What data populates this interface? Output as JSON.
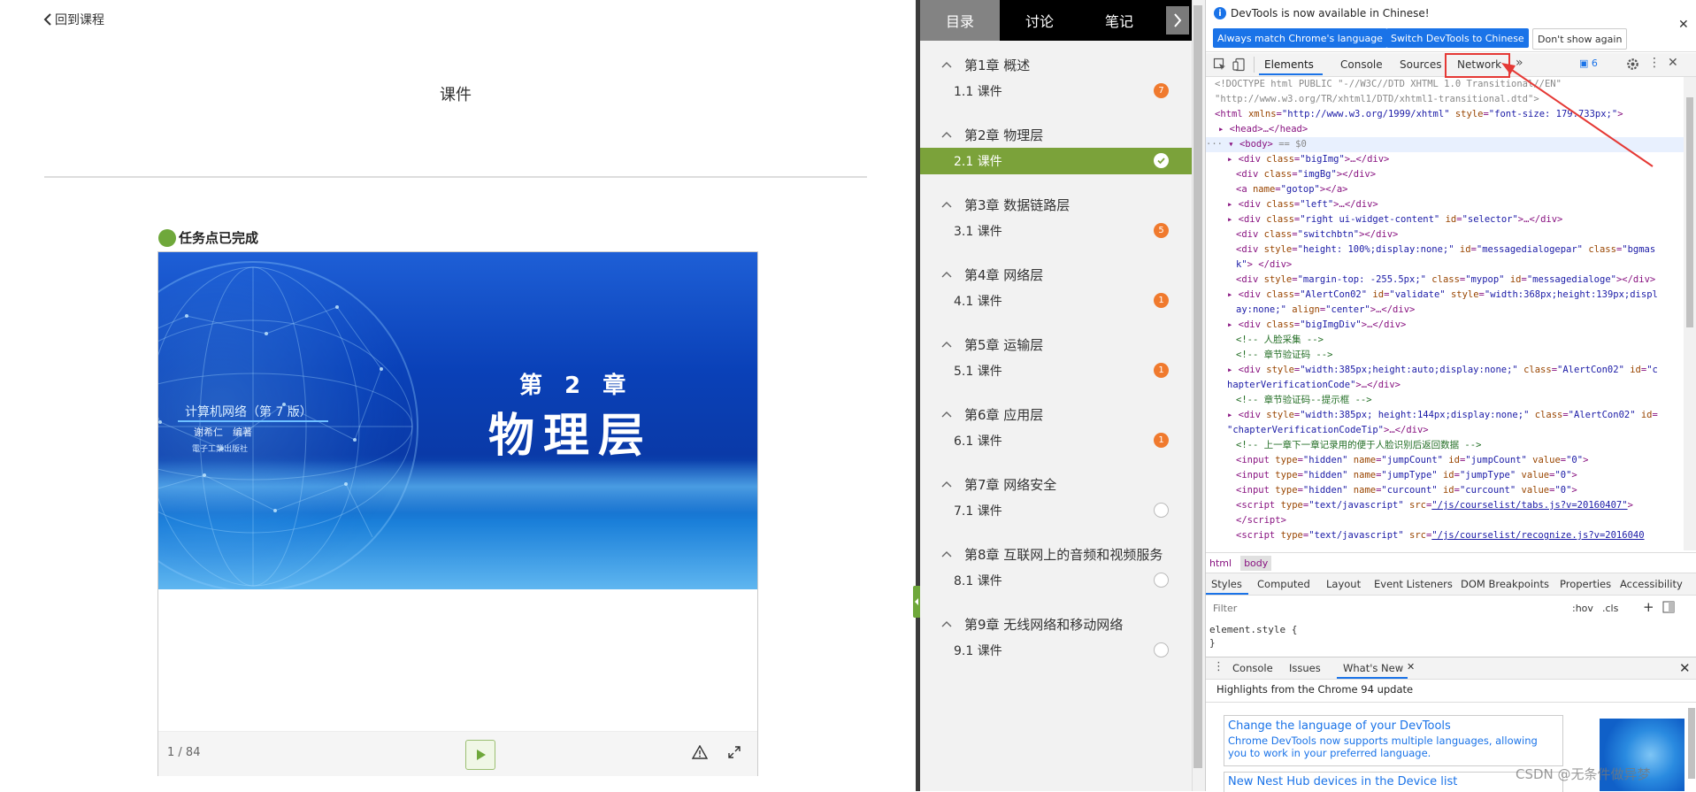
{
  "page": {
    "back_link": "回到课程",
    "title": "课件",
    "task_status": "任务点已完成"
  },
  "slide": {
    "chapter": "第 2 章",
    "title": "物理层",
    "book": "计算机网络（第 7 版）",
    "author": "谢希仁　编著",
    "publisher": "電子工業出版社"
  },
  "viewer": {
    "page_current": "1",
    "page_total": "/ 84"
  },
  "catalog": {
    "tabs": [
      "目录",
      "讨论",
      "笔记"
    ],
    "chapters": [
      {
        "title": "第1章 概述",
        "section": "1.1 课件",
        "badge": "7",
        "state": "num"
      },
      {
        "title": "第2章 物理层",
        "section": "2.1 课件",
        "badge": "",
        "state": "done"
      },
      {
        "title": "第3章 数据链路层",
        "section": "3.1 课件",
        "badge": "5",
        "state": "num"
      },
      {
        "title": "第4章 网络层",
        "section": "4.1 课件",
        "badge": "1",
        "state": "num"
      },
      {
        "title": "第5章 运输层",
        "section": "5.1 课件",
        "badge": "1",
        "state": "num"
      },
      {
        "title": "第6章 应用层",
        "section": "6.1 课件",
        "badge": "1",
        "state": "num"
      },
      {
        "title": "第7章 网络安全",
        "section": "7.1 课件",
        "badge": "",
        "state": "empty"
      },
      {
        "title": "第8章 互联网上的音频和视频服务",
        "section": "8.1 课件",
        "badge": "",
        "state": "empty"
      },
      {
        "title": "第9章 无线网络和移动网络",
        "section": "9.1 课件",
        "badge": "",
        "state": "empty"
      }
    ]
  },
  "devtools": {
    "info": "DevTools is now available in Chinese!",
    "btn_match": "Always match Chrome's language",
    "btn_switch": "Switch DevTools to Chinese",
    "btn_dont_show": "Don't show again",
    "tabs": [
      "Elements",
      "Console",
      "Sources",
      "Network"
    ],
    "message_count": "6",
    "breadcrumbs": [
      "html",
      "body"
    ],
    "style_tabs": [
      "Styles",
      "Computed",
      "Layout",
      "Event Listeners",
      "DOM Breakpoints",
      "Properties",
      "Accessibility"
    ],
    "filter_placeholder": "Filter",
    "hov": ":hov",
    "cls": ".cls",
    "element_style_1": "element.style {",
    "element_style_2": "}",
    "drawer_tabs": [
      "Console",
      "Issues",
      "What's New"
    ],
    "highlights": "Highlights from the Chrome 94 update",
    "card1_title": "Change the language of your DevTools",
    "card1_body": "Chrome DevTools now supports multiple languages, allowing you to work in your preferred language.",
    "card2_title": "New Nest Hub devices in the Device list",
    "watermark": "CSDN @无条件做异梦"
  },
  "colors": {
    "accent_green": "#7ba23a",
    "badge_orange": "#f07a2e",
    "devtools_blue": "#1a73e8",
    "highlight_red": "#e53935"
  }
}
